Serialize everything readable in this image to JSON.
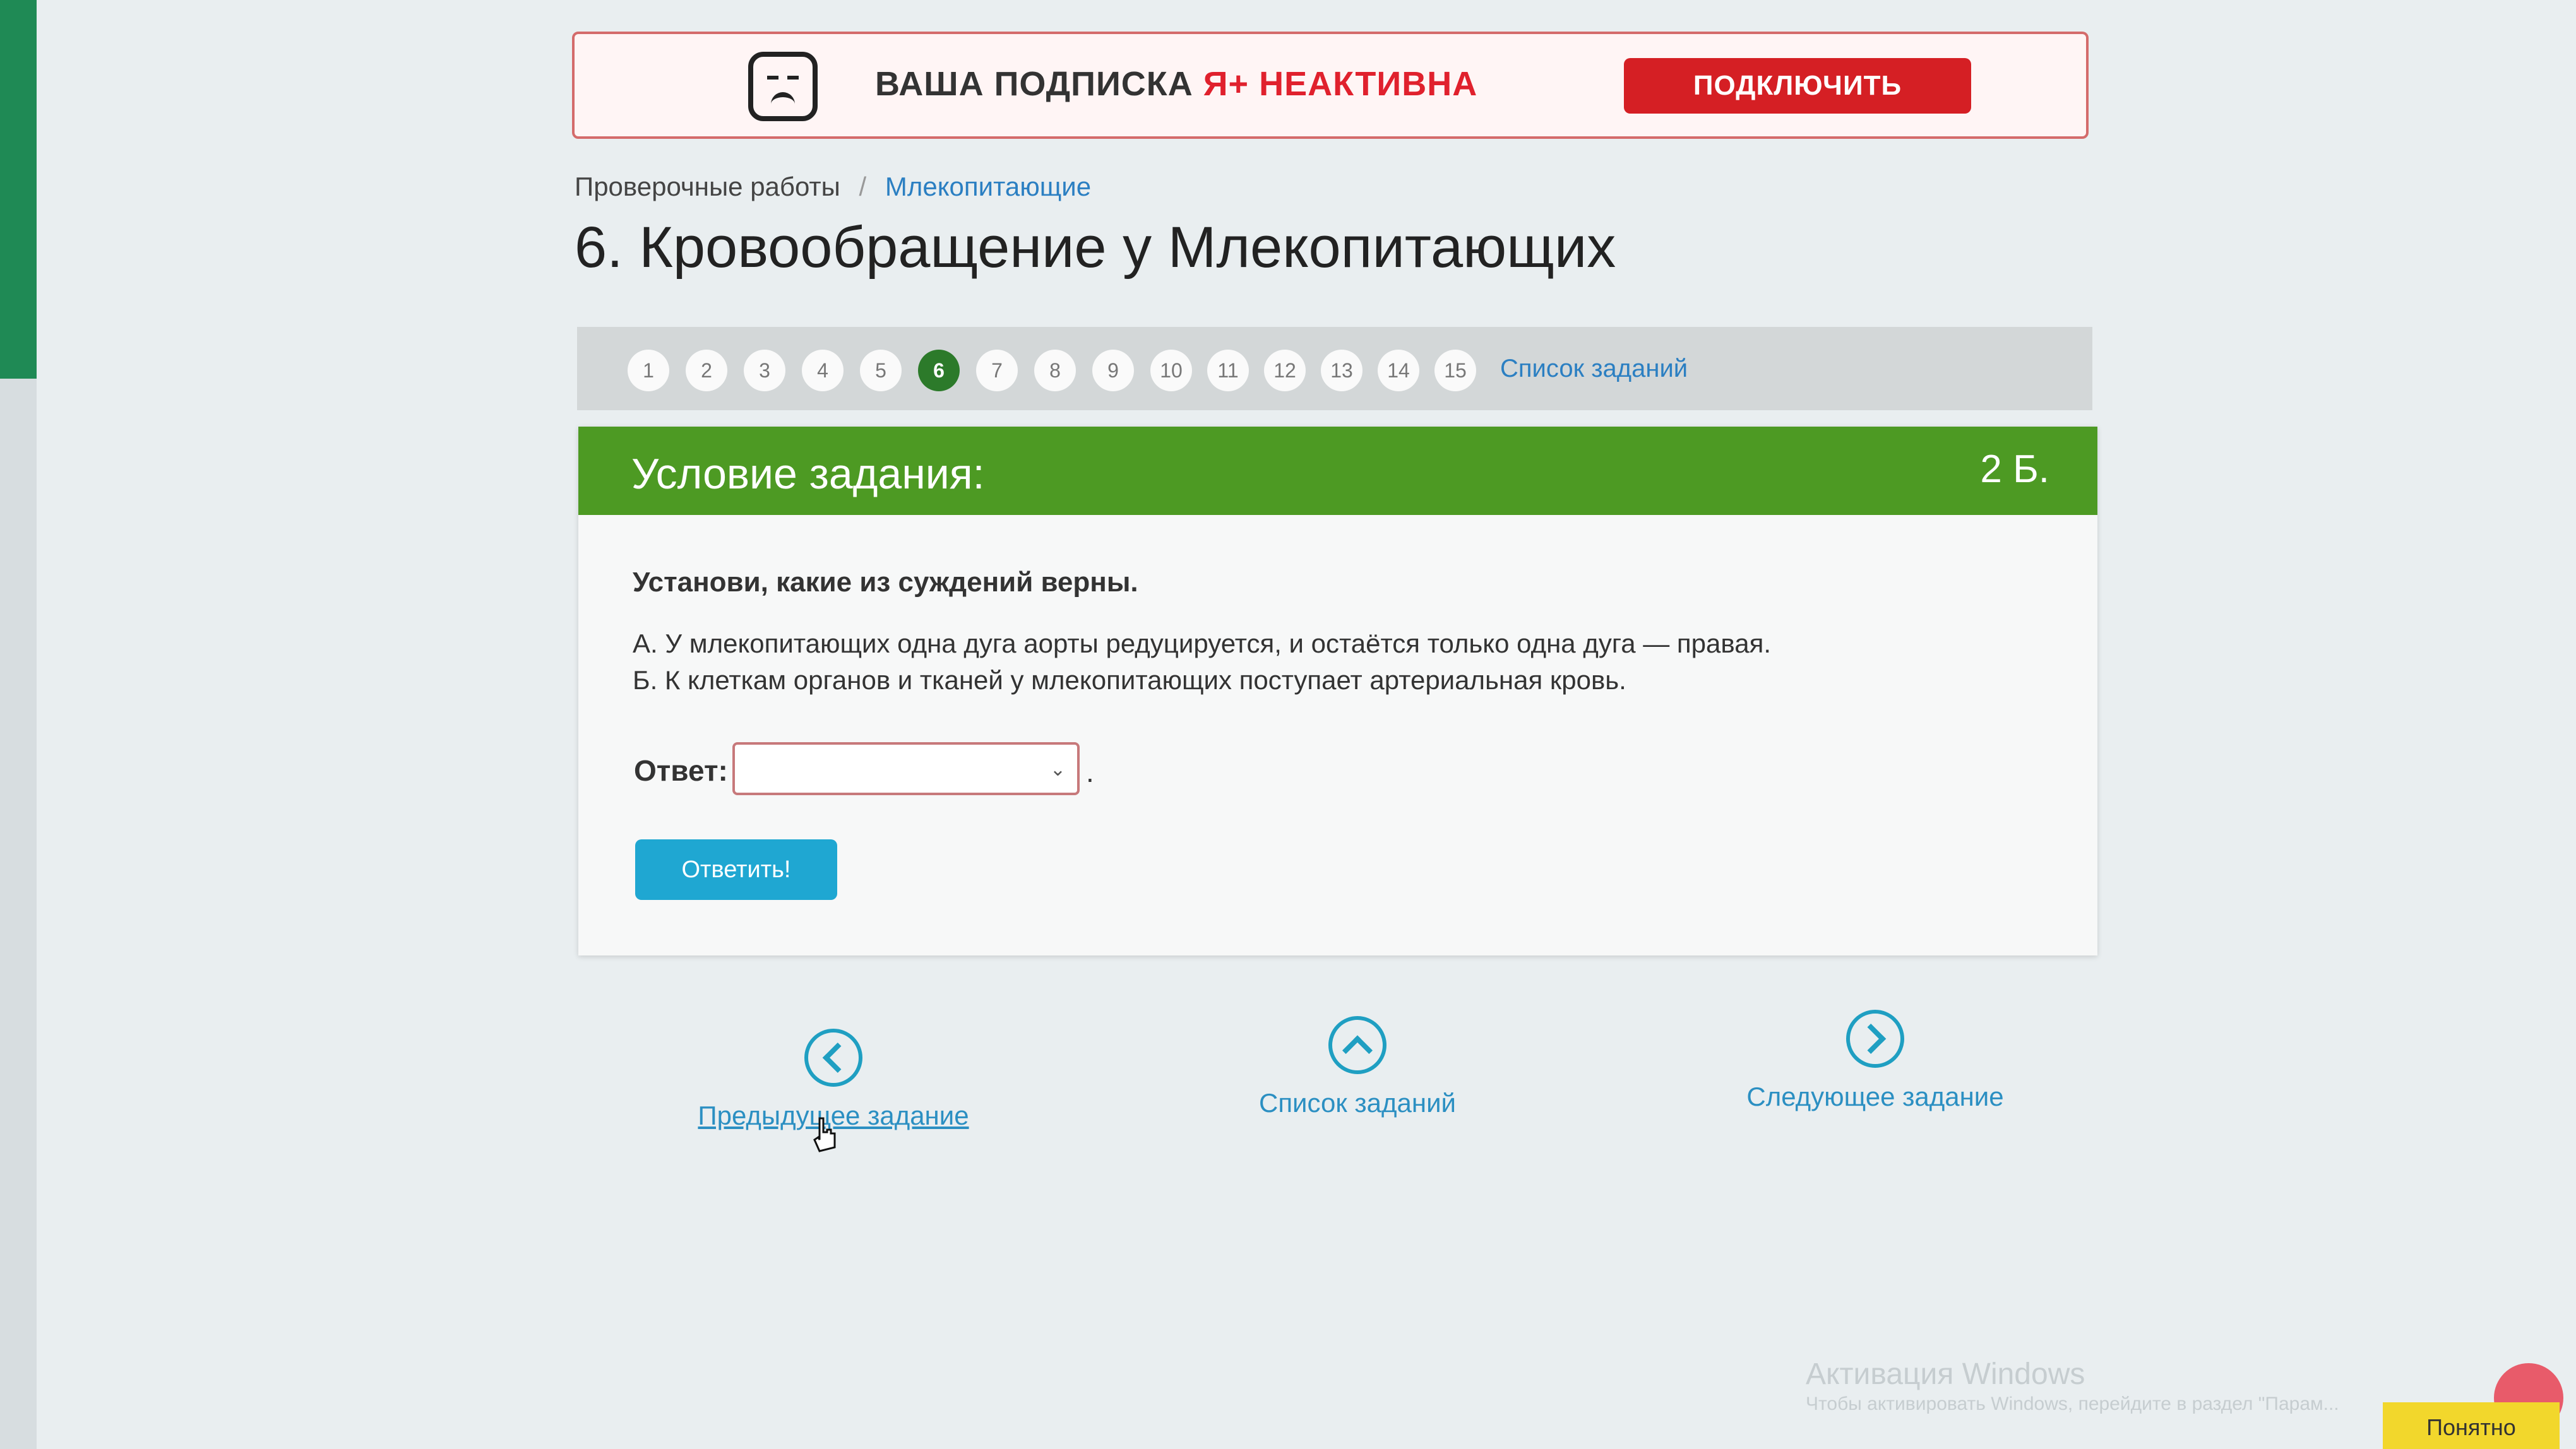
{
  "banner": {
    "text_prefix": "ВАША ПОДПИСКА ",
    "text_accent": "Я+ НЕАКТИВНА",
    "button_label": "ПОДКЛЮЧИТЬ",
    "icon": "sad-face-icon"
  },
  "breadcrumb": {
    "items": [
      "Проверочные работы",
      "Млекопитающие"
    ],
    "separator": "/"
  },
  "page": {
    "title": "6. Кровообращение у Млекопитающих"
  },
  "task_nav": {
    "numbers": [
      "1",
      "2",
      "3",
      "4",
      "5",
      "6",
      "7",
      "8",
      "9",
      "10",
      "11",
      "12",
      "13",
      "14",
      "15"
    ],
    "active": "6",
    "list_link": "Список заданий"
  },
  "task": {
    "header": "Условие задания:",
    "points": "2 Б.",
    "instruction": "Установи, какие из суждений верны.",
    "statements": [
      "А. У млекопитающих одна дуга аорты редуцируется, и остаётся только одна дуга — правая.",
      "Б. К клеткам органов и тканей у млекопитающих поступает артериальная кровь."
    ],
    "answer_label": "Ответ:",
    "answer_value": "",
    "answer_suffix": ".",
    "submit_label": "Ответить!"
  },
  "bottom_nav": {
    "prev_label": "Предыдущее задание",
    "list_label": "Список заданий",
    "next_label": "Следующее задание"
  },
  "watermark": {
    "title": "Активация Windows",
    "subtitle": "Чтобы активировать Windows, перейдите в раздел \"Парам..."
  },
  "popup": {
    "ok_label": "Понятно"
  },
  "colors": {
    "header_green": "#4d9a23",
    "active_task": "#2c7a2a",
    "submit_blue": "#1fa7d2",
    "banner_red": "#d51f24",
    "link_blue": "#2b7fc2"
  }
}
